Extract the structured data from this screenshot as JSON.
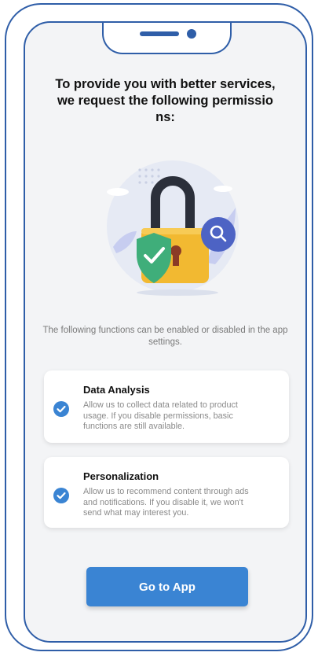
{
  "header": {
    "title_lines": [
      "To provide you with better services,",
      "we request the following permissio",
      "ns:"
    ]
  },
  "info": {
    "text": "The following functions can be enabled or disabled in the app settings."
  },
  "permissions": [
    {
      "title": "Data Analysis",
      "description_lines": [
        "Allow us to collect data related to product",
        "usage.  If you disable permissions, basic",
        "functions are still available."
      ],
      "checked": true
    },
    {
      "title": "Personalization",
      "description_lines": [
        "Allow us to recommend content through ads",
        "and notifications. If you disable it, we won't",
        "send what may interest you."
      ],
      "checked": true
    }
  ],
  "action": {
    "label": "Go to App"
  },
  "colors": {
    "accent": "#3a84d3",
    "frame": "#2f5ea8",
    "lock": "#f2b931",
    "shield": "#3fae7a",
    "magnifier": "#4d63c4"
  },
  "icons": {
    "illustration": "padlock-shield-magnifier-illustration",
    "check": "check-circle-icon"
  }
}
